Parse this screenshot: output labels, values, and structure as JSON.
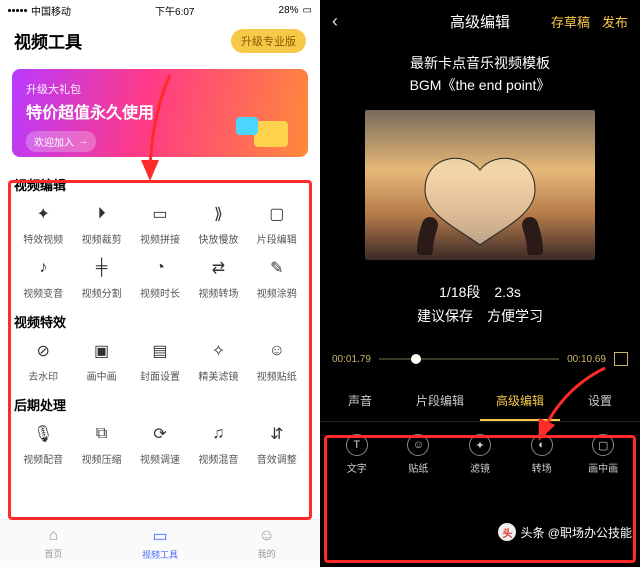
{
  "left": {
    "status": {
      "carrier": "中国移动",
      "time": "下午6:07",
      "battery": "28%"
    },
    "header": {
      "title": "视频工具",
      "pro_btn": "升级专业版"
    },
    "promo": {
      "line1": "升级大礼包",
      "line2": "特价超值永久使用",
      "join": "欢迎加入",
      "arrow": "→"
    },
    "sections": [
      {
        "title": "视频编辑",
        "tools": [
          {
            "icon": "✦",
            "label": "特效视频"
          },
          {
            "icon": "⏵",
            "label": "视频裁剪"
          },
          {
            "icon": "▭",
            "label": "视频拼接"
          },
          {
            "icon": "⟫",
            "label": "快放慢放"
          },
          {
            "icon": "▢",
            "label": "片段编辑"
          },
          {
            "icon": "♪",
            "label": "视频变音"
          },
          {
            "icon": "╪",
            "label": "视频分割"
          },
          {
            "icon": "◔",
            "label": "视频时长"
          },
          {
            "icon": "⇄",
            "label": "视频转场"
          },
          {
            "icon": "✎",
            "label": "视频涂鸦"
          }
        ]
      },
      {
        "title": "视频特效",
        "tools": [
          {
            "icon": "⊘",
            "label": "去水印"
          },
          {
            "icon": "▣",
            "label": "画中画"
          },
          {
            "icon": "▤",
            "label": "封面设置"
          },
          {
            "icon": "✧",
            "label": "精美滤镜"
          },
          {
            "icon": "☺",
            "label": "视频贴纸"
          }
        ]
      },
      {
        "title": "后期处理",
        "tools": [
          {
            "icon": "🎙",
            "label": "视频配音"
          },
          {
            "icon": "⧉",
            "label": "视频压缩"
          },
          {
            "icon": "⟳",
            "label": "视频调速"
          },
          {
            "icon": "♫",
            "label": "视频混音"
          },
          {
            "icon": "⇵",
            "label": "音效调整"
          }
        ]
      }
    ],
    "tabbar": [
      {
        "icon": "⌂",
        "label": "首页"
      },
      {
        "icon": "▭",
        "label": "视频工具"
      },
      {
        "icon": "☺",
        "label": "我的"
      }
    ]
  },
  "right": {
    "header": {
      "title": "高级编辑",
      "draft": "存草稿",
      "publish": "发布"
    },
    "template_title_1": "最新卡点音乐视频模板",
    "template_title_2": "BGM《the end point》",
    "segment": "1/18段",
    "duration": "2.3s",
    "tip1": "建议保存",
    "tip2": "方便学习",
    "time_start": "00:01.79",
    "time_end": "00:10.69",
    "tabs": [
      "声音",
      "片段编辑",
      "高级编辑",
      "设置"
    ],
    "tools": [
      {
        "icon": "T",
        "label": "文字"
      },
      {
        "icon": "☺",
        "label": "贴纸"
      },
      {
        "icon": "✦",
        "label": "滤镜"
      },
      {
        "icon": "◐",
        "label": "转场"
      },
      {
        "icon": "▢",
        "label": "画中画"
      }
    ],
    "watermark": "头条 @职场办公技能"
  }
}
